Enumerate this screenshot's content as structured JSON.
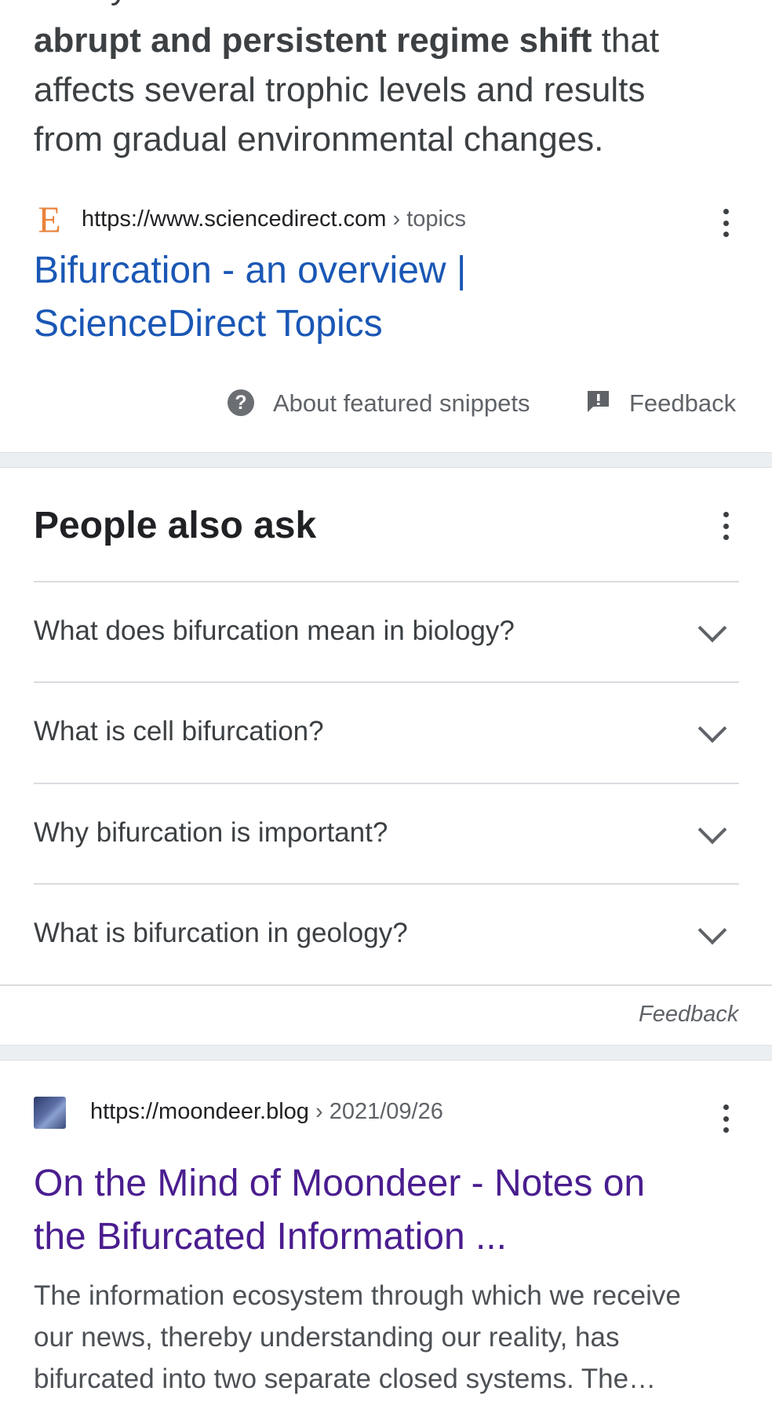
{
  "snippet": {
    "line0": "Ecosystem bifurcation is defined as an",
    "bold": "abrupt and persistent regime shift",
    "after_bold": " that",
    "line2": "affects several trophic levels and results",
    "line3": "from gradual environmental changes."
  },
  "result1": {
    "favicon_letter": "E",
    "url": "https://www.sciencedirect.com",
    "crumb": " › topics",
    "title_line1": "Bifurcation - an overview |",
    "title_line2": "ScienceDirect Topics",
    "more_icon": "more-vert-icon"
  },
  "snippet_footer": {
    "help_glyph": "?",
    "about_label": "About featured snippets",
    "feedback_label": "Feedback"
  },
  "paa": {
    "heading": "People also ask",
    "questions": [
      "What does bifurcation mean in biology?",
      "What is cell bifurcation?",
      "Why bifurcation is important?",
      "What is bifurcation in geology?"
    ],
    "feedback_label": "Feedback"
  },
  "result2": {
    "url": "https://moondeer.blog",
    "crumb": " › 2021/09/26",
    "title_line1": "On the Mind of Moondeer - Notes on",
    "title_line2": "the Bifurcated Information ...",
    "desc_line1": "The information ecosystem through which we receive",
    "desc_line2": "our news, thereby understanding our reality, has",
    "desc_line3": "bifurcated into two separate closed systems. The…"
  },
  "colors": {
    "link": "#1a57b5",
    "visited_link": "#4a1d8f",
    "favicon_e": "#e9833b",
    "separator_band": "#eceff1"
  }
}
